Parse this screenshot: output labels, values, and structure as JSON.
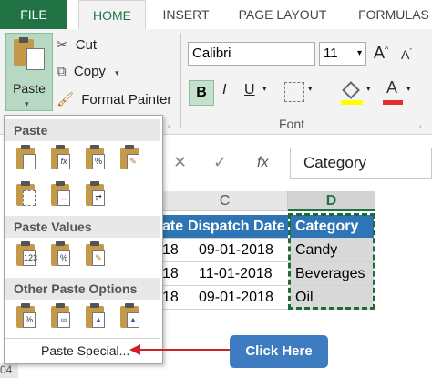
{
  "ribbon": {
    "tabs": [
      "FILE",
      "HOME",
      "INSERT",
      "PAGE LAYOUT",
      "FORMULAS"
    ],
    "clipboard": {
      "paste_label": "Paste",
      "cut_label": "Cut",
      "copy_label": "Copy",
      "format_painter_label": "Format Painter"
    },
    "font": {
      "name": "Calibri",
      "size": "11",
      "group_label": "Font",
      "bold": "B",
      "italic": "I",
      "underline": "U"
    }
  },
  "formula_bar": {
    "fx": "fx",
    "value": "Category"
  },
  "grid": {
    "col_c": "C",
    "col_d": "D",
    "header_partial": "ate",
    "header_dispatch": "Dispatch Date",
    "header_category": "Category",
    "rows": [
      {
        "prefix": "18",
        "dispatch": "09-01-2018",
        "category": "Candy"
      },
      {
        "prefix": "18",
        "dispatch": "11-01-2018",
        "category": "Beverages"
      },
      {
        "prefix": "18",
        "dispatch": "09-01-2018",
        "category": "Oil"
      }
    ],
    "row_number_partial": "04"
  },
  "paste_menu": {
    "paste_header": "Paste",
    "paste_values_header": "Paste Values",
    "other_options_header": "Other Paste Options",
    "paste_special_label": "Paste Special...",
    "callout": "Click Here"
  },
  "colors": {
    "excel_green": "#217346",
    "callout_blue": "#3d7cc0",
    "arrow_red": "#d0202a",
    "selection_border": "#1e6b38"
  }
}
